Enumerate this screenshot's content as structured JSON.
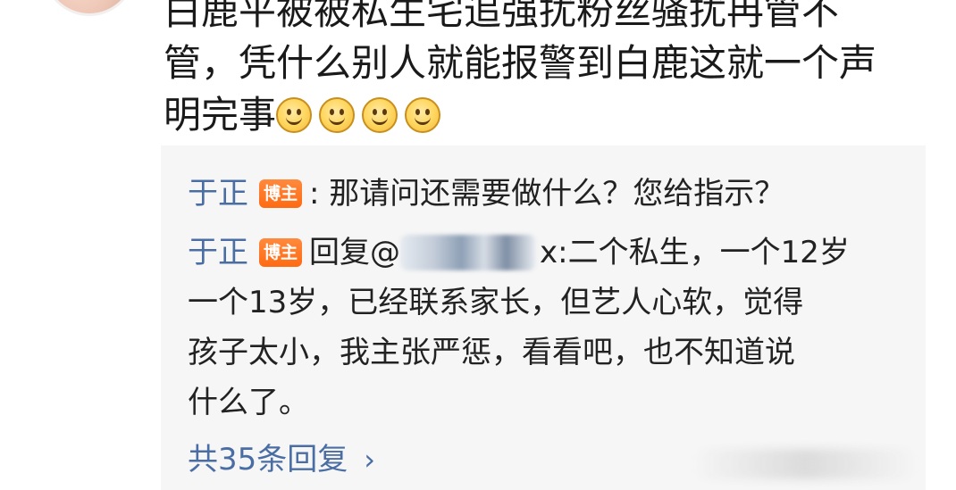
{
  "comment": {
    "lines": [
      "白鹿平被被私生宅追强扰粉丝骚扰冉管不",
      "管，凭什么别人就能报警到白鹿这就一个声",
      "明完事"
    ],
    "emoji_count": 4
  },
  "replies": [
    {
      "author": "于正",
      "badge": "博主",
      "text": ": 那请问还需要做什么？您给指示？"
    },
    {
      "author": "于正",
      "badge": "博主",
      "prefix": "回复@",
      "suffix": "x:",
      "lines": [
        "二个私生，一个12岁",
        "一个13岁，已经联系家长，但艺人心软，觉得",
        "孩子太小，我主张严惩，看看吧，也不知道说",
        "什么了。"
      ]
    }
  ],
  "more_replies": {
    "label": "共35条回复",
    "chevron": "›"
  }
}
